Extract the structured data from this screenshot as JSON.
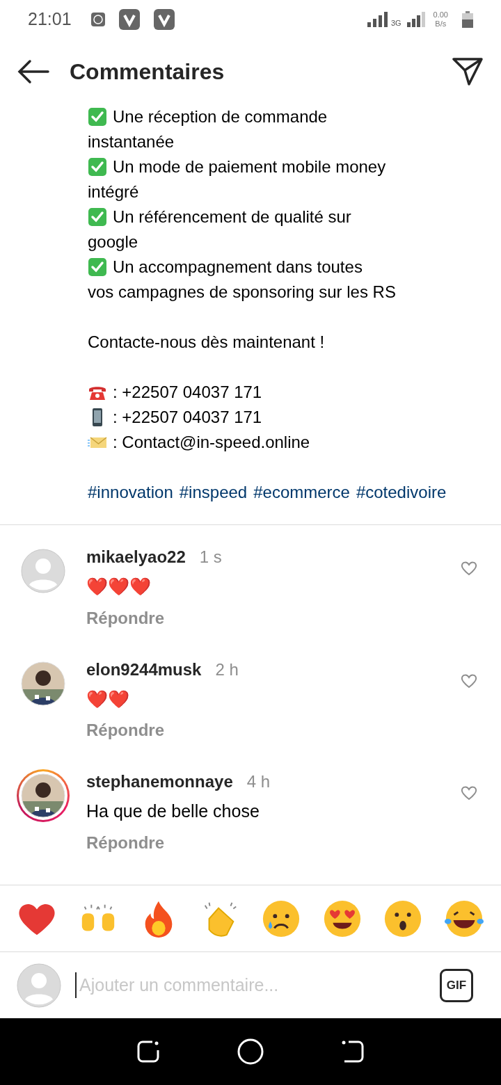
{
  "status_bar": {
    "time": "21:01",
    "network": "3G",
    "speed": "0.00",
    "speed_unit": "B/s"
  },
  "header": {
    "title": "Commentaires"
  },
  "post": {
    "sections": [
      {
        "items": [
          {
            "kind": "check",
            "lines": [
              "Une réception de commande",
              "instantanée"
            ]
          },
          {
            "kind": "check",
            "lines": [
              "Un mode de paiement mobile money",
              "intégré"
            ]
          },
          {
            "kind": "check",
            "lines": [
              "Un référencement de qualité sur",
              "google"
            ]
          },
          {
            "kind": "check",
            "lines": [
              "Un accompagnement dans toutes",
              "vos campagnes de sponsoring sur les RS"
            ]
          }
        ]
      },
      {
        "items": [
          {
            "kind": "text",
            "lines": [
              "Contacte-nous dès maintenant !"
            ]
          }
        ]
      },
      {
        "items": [
          {
            "kind": "phone",
            "lines": [
              ": +22507 04037 171"
            ]
          },
          {
            "kind": "mobile",
            "lines": [
              ": +22507 04037 171"
            ]
          },
          {
            "kind": "mail",
            "lines": [
              ": Contact@in-speed.online"
            ]
          }
        ]
      },
      {
        "hashtags": [
          "#innovation",
          "#inspeed",
          "#ecommerce",
          "#cotedivoire"
        ]
      }
    ]
  },
  "comments": [
    {
      "user": "mikaelyao22",
      "time": "1 s",
      "text": "❤️❤️❤️",
      "reply": "Répondre",
      "avatar": {
        "kind": "default"
      },
      "story_ring": false
    },
    {
      "user": "elon9244musk",
      "time": "2 h",
      "text": "❤️❤️",
      "reply": "Répondre",
      "story_ring": false
    },
    {
      "user": "stephanemonnaye",
      "time": "4 h",
      "text": "Ha que de belle chose",
      "reply": "Répondre",
      "story_ring": true
    }
  ],
  "reactions": [
    {
      "kind": "heart"
    },
    {
      "kind": "raised-hands"
    },
    {
      "kind": "fire"
    },
    {
      "kind": "clap"
    },
    {
      "kind": "sad"
    },
    {
      "kind": "heart-eyes"
    },
    {
      "kind": "surprised"
    },
    {
      "kind": "laugh"
    }
  ],
  "composer": {
    "placeholder": "Ajouter un commentaire...",
    "gif": "GIF"
  }
}
